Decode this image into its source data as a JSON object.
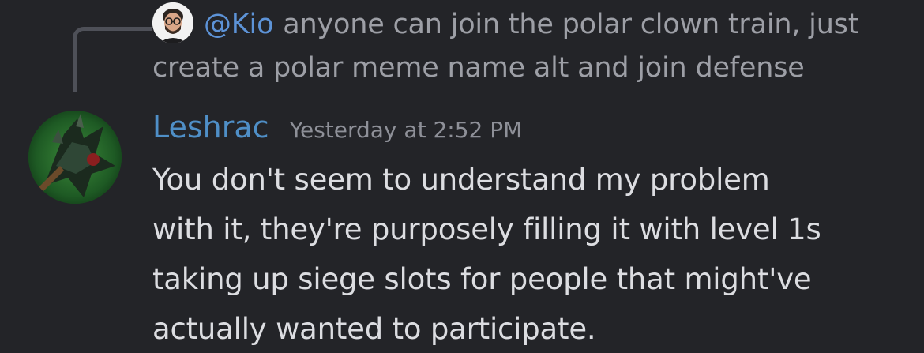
{
  "reply": {
    "mention": "@Kio",
    "text_line1": "anyone can join the polar clown train, just",
    "text_line2": "create a polar meme name alt and join defense"
  },
  "message": {
    "author": "Leshrac",
    "timestamp": "Yesterday at 2:52 PM",
    "lines": [
      "You don't seem to understand my problem",
      "with it, they're purposely filling it with level 1s",
      "taking up siege slots for people that might've",
      "actually wanted to participate."
    ]
  },
  "colors": {
    "background": "#232428",
    "mention": "#5d93d7",
    "author": "#4f8fc7",
    "body_text": "#dcdde1",
    "muted_text": "#9d9fa6"
  }
}
